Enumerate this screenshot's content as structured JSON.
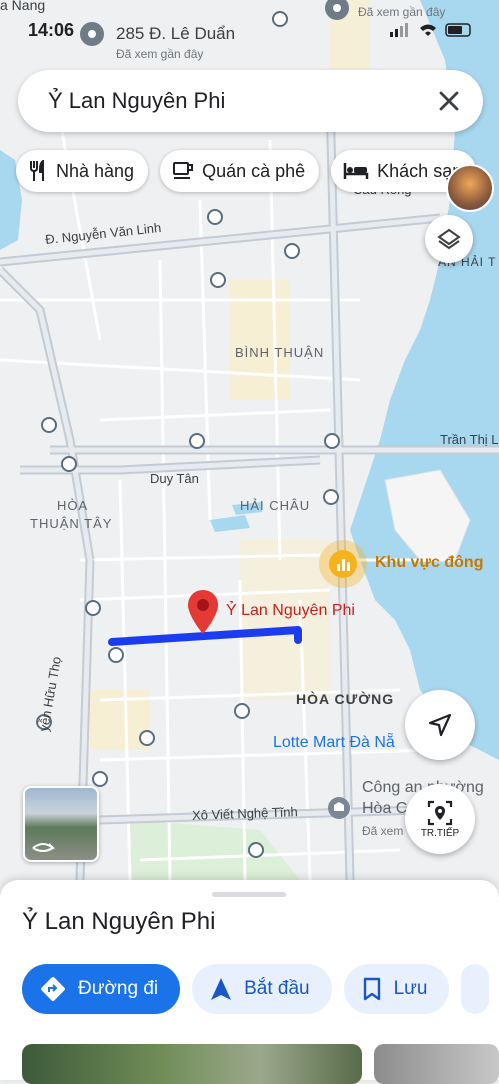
{
  "status_bar": {
    "time": "14:06"
  },
  "map": {
    "top_labels": {
      "city_partial": "a Nang",
      "address": "285 Đ. Lê Duẩn",
      "address_sub": "Đã xem gần đây",
      "viewed_top_right": "Đã xem gần đây"
    },
    "districts": {
      "binh_thuan": "BÌNH THUẬN",
      "hai_chau": "HẢI CHÂU",
      "hoa_thuan_tay_1": "HÒA",
      "hoa_thuan_tay_2": "THUẬN TÂY",
      "hoa_cuong": "HÒA CƯỜNG"
    },
    "roads": {
      "nguyen_van_linh": "Đ. Nguyễn Văn Linh",
      "duy_tan": "Duy Tân",
      "tran_thi_ly": "Trần Thị L",
      "xo_viet_nghe_tinh": "Xô Viết Nghệ Tĩnh",
      "nguyen_huu_tho": "yễn Hữu Thọ",
      "cau_rong": "Cầu Rồng",
      "an_hai": "AN HẢI T"
    },
    "pins": {
      "selected_street": "Ỷ Lan Nguyên Phi",
      "area": "Khu vực đông",
      "lotte": "Lotte Mart Đà Nẵ",
      "police_1": "Công an phường",
      "police_2": "Hòa C",
      "police_sub": "Đã xem"
    },
    "colors": {
      "route": "#1c3cf0",
      "water": "#a8d8f0",
      "pin": "#e53935",
      "area_pin": "#f6b21c"
    }
  },
  "search": {
    "query": "Ỷ Lan Nguyên Phi"
  },
  "chips": [
    {
      "label": "Nhà hàng",
      "icon": "restaurant-icon"
    },
    {
      "label": "Quán cà phê",
      "icon": "coffee-icon"
    },
    {
      "label": "Khách sạn",
      "icon": "hotel-icon"
    }
  ],
  "fabs": {
    "nearby_label": "TR.TIẾP"
  },
  "sheet": {
    "title": "Ỷ Lan Nguyên Phi",
    "actions": [
      {
        "label": "Đường đi",
        "icon": "directions-icon"
      },
      {
        "label": "Bắt đầu",
        "icon": "navigate-icon"
      },
      {
        "label": "Lưu",
        "icon": "bookmark-icon"
      }
    ]
  }
}
